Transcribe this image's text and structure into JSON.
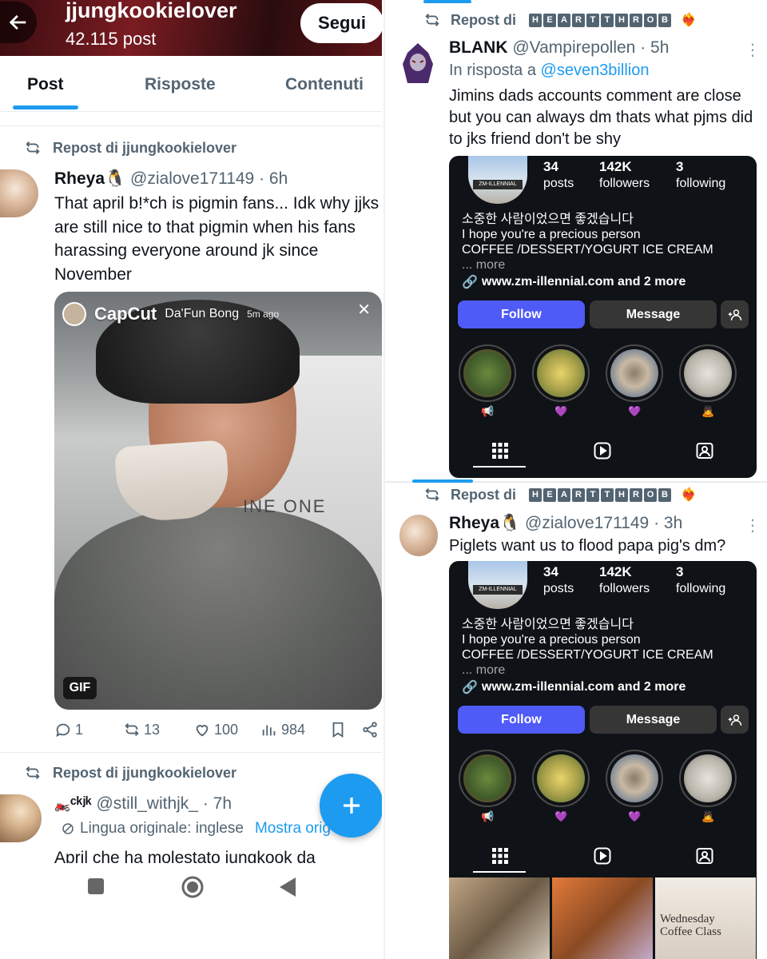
{
  "left": {
    "profile": {
      "handle": "jjungkookielover",
      "post_count": "42.115 post",
      "follow_label": "Segui"
    },
    "tabs": [
      "Post",
      "Risposte",
      "Contenuti"
    ],
    "tweet1": {
      "repost_label": "Repost di jjungkookielover",
      "name": "Rheya🐧",
      "handle_time": "@zialove171149 · 6h",
      "text": "That april  b!*ch is pigmin fans... Idk why jjks are still nice to that pigmin when his fans harassing everyone around jk since November",
      "media": {
        "overlay_app": "CapCut",
        "story_name": "Da'Fun Bong",
        "story_time": "5m ago",
        "wall_text": "INE ONE",
        "badge": "GIF"
      },
      "replies": "1",
      "reposts": "13",
      "likes": "100",
      "views": "984"
    },
    "tweet2": {
      "repost_label": "Repost di jjungkookielover",
      "name": "ᶜᵏʲᵏ",
      "handle_time": "@still_withjk_ · 7h",
      "lang_note": "Lingua originale: inglese",
      "show_original": "Mostra orig",
      "cut_text": "April che ha molestato jungkook da"
    }
  },
  "right": {
    "post1": {
      "repost_label": "Repost di",
      "repost_tag": [
        "H",
        "E",
        "A",
        "R",
        "T",
        "T",
        "H",
        "R",
        "O",
        "B"
      ],
      "name": "BLANK",
      "handle_time": "@Vampirepollen · 5h",
      "reply_prefix": "In risposta a",
      "reply_to": "@seven3billion",
      "text": "Jimins dads accounts comment are close but you can always dm thats what pjms did to jks friend don't be shy"
    },
    "post2": {
      "repost_label": "Repost di",
      "repost_tag": [
        "H",
        "E",
        "A",
        "R",
        "T",
        "T",
        "H",
        "R",
        "O",
        "B"
      ],
      "name": "Rheya🐧",
      "handle_time": "@zialove171149 · 3h",
      "text": "Piglets want us to flood papa pig's dm?"
    },
    "ig": {
      "pic_sign": "ZM-ILLENNIAL",
      "posts_n": "34",
      "posts_l": "posts",
      "followers_n": "142K",
      "followers_l": "followers",
      "following_n": "3",
      "following_l": "following",
      "bio_ko": "소중한 사람이었으면 좋겠습니다",
      "bio_en": "I hope you're a precious person",
      "bio_menu": "COFFEE /DESSERT/YOGURT ICE CREAM",
      "bio_more": "... more",
      "link": "www.zm-illennial.com and 2 more",
      "follow": "Follow",
      "message": "Message",
      "highlight_emojis": [
        "📢",
        "💜",
        "💜",
        "🙇"
      ],
      "thumb_text": "Wednesday\nCoffee Class"
    }
  }
}
